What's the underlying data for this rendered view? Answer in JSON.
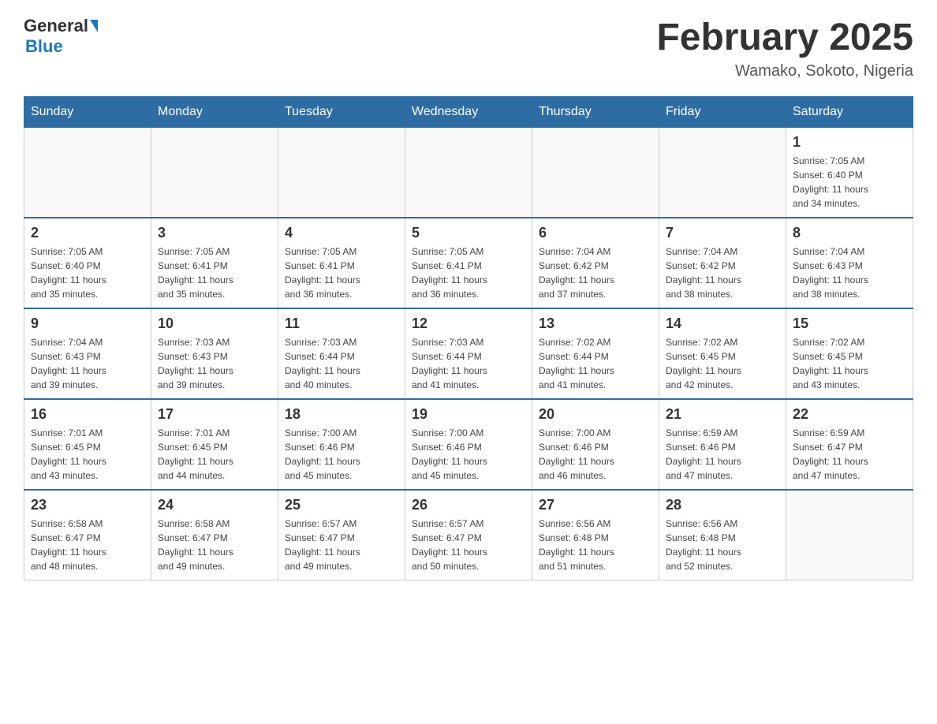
{
  "header": {
    "logo": {
      "general": "General",
      "triangle": "▶",
      "blue": "Blue"
    },
    "title": "February 2025",
    "location": "Wamako, Sokoto, Nigeria"
  },
  "calendar": {
    "days_of_week": [
      "Sunday",
      "Monday",
      "Tuesday",
      "Wednesday",
      "Thursday",
      "Friday",
      "Saturday"
    ],
    "weeks": [
      {
        "cells": [
          {
            "day": "",
            "info": ""
          },
          {
            "day": "",
            "info": ""
          },
          {
            "day": "",
            "info": ""
          },
          {
            "day": "",
            "info": ""
          },
          {
            "day": "",
            "info": ""
          },
          {
            "day": "",
            "info": ""
          },
          {
            "day": "1",
            "info": "Sunrise: 7:05 AM\nSunset: 6:40 PM\nDaylight: 11 hours\nand 34 minutes."
          }
        ]
      },
      {
        "cells": [
          {
            "day": "2",
            "info": "Sunrise: 7:05 AM\nSunset: 6:40 PM\nDaylight: 11 hours\nand 35 minutes."
          },
          {
            "day": "3",
            "info": "Sunrise: 7:05 AM\nSunset: 6:41 PM\nDaylight: 11 hours\nand 35 minutes."
          },
          {
            "day": "4",
            "info": "Sunrise: 7:05 AM\nSunset: 6:41 PM\nDaylight: 11 hours\nand 36 minutes."
          },
          {
            "day": "5",
            "info": "Sunrise: 7:05 AM\nSunset: 6:41 PM\nDaylight: 11 hours\nand 36 minutes."
          },
          {
            "day": "6",
            "info": "Sunrise: 7:04 AM\nSunset: 6:42 PM\nDaylight: 11 hours\nand 37 minutes."
          },
          {
            "day": "7",
            "info": "Sunrise: 7:04 AM\nSunset: 6:42 PM\nDaylight: 11 hours\nand 38 minutes."
          },
          {
            "day": "8",
            "info": "Sunrise: 7:04 AM\nSunset: 6:43 PM\nDaylight: 11 hours\nand 38 minutes."
          }
        ]
      },
      {
        "cells": [
          {
            "day": "9",
            "info": "Sunrise: 7:04 AM\nSunset: 6:43 PM\nDaylight: 11 hours\nand 39 minutes."
          },
          {
            "day": "10",
            "info": "Sunrise: 7:03 AM\nSunset: 6:43 PM\nDaylight: 11 hours\nand 39 minutes."
          },
          {
            "day": "11",
            "info": "Sunrise: 7:03 AM\nSunset: 6:44 PM\nDaylight: 11 hours\nand 40 minutes."
          },
          {
            "day": "12",
            "info": "Sunrise: 7:03 AM\nSunset: 6:44 PM\nDaylight: 11 hours\nand 41 minutes."
          },
          {
            "day": "13",
            "info": "Sunrise: 7:02 AM\nSunset: 6:44 PM\nDaylight: 11 hours\nand 41 minutes."
          },
          {
            "day": "14",
            "info": "Sunrise: 7:02 AM\nSunset: 6:45 PM\nDaylight: 11 hours\nand 42 minutes."
          },
          {
            "day": "15",
            "info": "Sunrise: 7:02 AM\nSunset: 6:45 PM\nDaylight: 11 hours\nand 43 minutes."
          }
        ]
      },
      {
        "cells": [
          {
            "day": "16",
            "info": "Sunrise: 7:01 AM\nSunset: 6:45 PM\nDaylight: 11 hours\nand 43 minutes."
          },
          {
            "day": "17",
            "info": "Sunrise: 7:01 AM\nSunset: 6:45 PM\nDaylight: 11 hours\nand 44 minutes."
          },
          {
            "day": "18",
            "info": "Sunrise: 7:00 AM\nSunset: 6:46 PM\nDaylight: 11 hours\nand 45 minutes."
          },
          {
            "day": "19",
            "info": "Sunrise: 7:00 AM\nSunset: 6:46 PM\nDaylight: 11 hours\nand 45 minutes."
          },
          {
            "day": "20",
            "info": "Sunrise: 7:00 AM\nSunset: 6:46 PM\nDaylight: 11 hours\nand 46 minutes."
          },
          {
            "day": "21",
            "info": "Sunrise: 6:59 AM\nSunset: 6:46 PM\nDaylight: 11 hours\nand 47 minutes."
          },
          {
            "day": "22",
            "info": "Sunrise: 6:59 AM\nSunset: 6:47 PM\nDaylight: 11 hours\nand 47 minutes."
          }
        ]
      },
      {
        "cells": [
          {
            "day": "23",
            "info": "Sunrise: 6:58 AM\nSunset: 6:47 PM\nDaylight: 11 hours\nand 48 minutes."
          },
          {
            "day": "24",
            "info": "Sunrise: 6:58 AM\nSunset: 6:47 PM\nDaylight: 11 hours\nand 49 minutes."
          },
          {
            "day": "25",
            "info": "Sunrise: 6:57 AM\nSunset: 6:47 PM\nDaylight: 11 hours\nand 49 minutes."
          },
          {
            "day": "26",
            "info": "Sunrise: 6:57 AM\nSunset: 6:47 PM\nDaylight: 11 hours\nand 50 minutes."
          },
          {
            "day": "27",
            "info": "Sunrise: 6:56 AM\nSunset: 6:48 PM\nDaylight: 11 hours\nand 51 minutes."
          },
          {
            "day": "28",
            "info": "Sunrise: 6:56 AM\nSunset: 6:48 PM\nDaylight: 11 hours\nand 52 minutes."
          },
          {
            "day": "",
            "info": ""
          }
        ]
      }
    ]
  }
}
